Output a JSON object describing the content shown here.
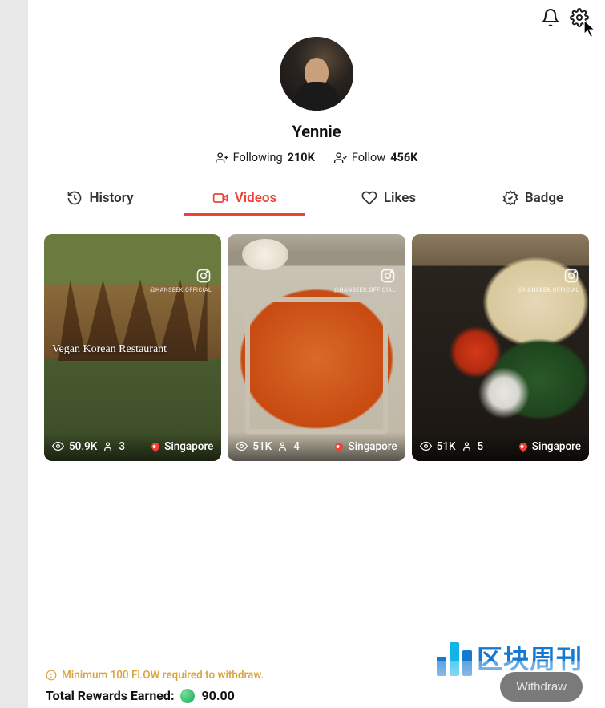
{
  "profile": {
    "username": "Yennie",
    "following_label": "Following",
    "following_count": "210K",
    "follow_label": "Follow",
    "follow_count": "456K"
  },
  "tabs": [
    {
      "id": "history",
      "label": "History",
      "icon": "history-icon",
      "active": false
    },
    {
      "id": "videos",
      "label": "Videos",
      "icon": "video-icon",
      "active": true
    },
    {
      "id": "likes",
      "label": "Likes",
      "icon": "heart-icon",
      "active": false
    },
    {
      "id": "badge",
      "label": "Badge",
      "icon": "badge-icon",
      "active": false
    }
  ],
  "videos": [
    {
      "overlay_title": "Vegan Korean Restaurant",
      "ig_handle": "@HANSEEK.OFFICIAL",
      "views": "50.9K",
      "engagement": "3",
      "location": "Singapore"
    },
    {
      "overlay_title": "",
      "ig_handle": "@HANSEEK.OFFICIAL",
      "views": "51K",
      "engagement": "4",
      "location": "Singapore"
    },
    {
      "overlay_title": "",
      "ig_handle": "@HANSEEK.OFFICIAL",
      "views": "51K",
      "engagement": "5",
      "location": "Singapore"
    }
  ],
  "footer": {
    "warning": "Minimum 100 FLOW required to withdraw.",
    "rewards_label": "Total Rewards Earned:",
    "rewards_value": "90.00",
    "withdraw_label": "Withdraw"
  },
  "watermark": {
    "text": "区块周刊"
  }
}
